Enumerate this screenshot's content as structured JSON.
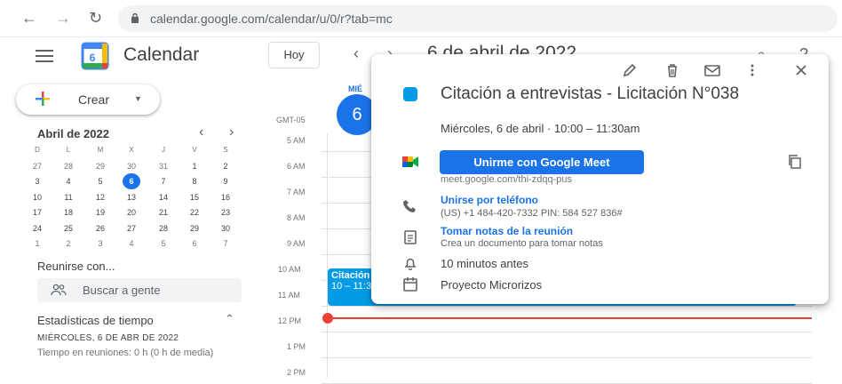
{
  "browser": {
    "url": "calendar.google.com/calendar/u/0/r?tab=mc"
  },
  "header": {
    "app_title": "Calendar",
    "logo_number": "6",
    "today_label": "Hoy",
    "date_title": "6 de abril de 2022"
  },
  "sidebar": {
    "create_label": "Crear",
    "mini_calendar": {
      "title": "Abril de 2022",
      "weekdays": [
        "D",
        "L",
        "M",
        "X",
        "J",
        "V",
        "S"
      ],
      "weeks": [
        [
          "27",
          "28",
          "29",
          "30",
          "31",
          "1",
          "2"
        ],
        [
          "3",
          "4",
          "5",
          "6",
          "7",
          "8",
          "9"
        ],
        [
          "10",
          "11",
          "12",
          "13",
          "14",
          "15",
          "16"
        ],
        [
          "17",
          "18",
          "19",
          "20",
          "21",
          "22",
          "23"
        ],
        [
          "24",
          "25",
          "26",
          "27",
          "28",
          "29",
          "30"
        ],
        [
          "1",
          "2",
          "3",
          "4",
          "5",
          "6",
          "7"
        ]
      ],
      "selected_day": "6"
    },
    "meet_title": "Reunirse con...",
    "search_people_placeholder": "Buscar a gente",
    "stats_title": "Estadísticas de tiempo",
    "stats_date": "MIÉRCOLES, 6 DE ABR DE 2022",
    "stats_info": "Tiempo en reuniones: 0 h (0 h de media)"
  },
  "day_view": {
    "dow_label": "MIÉ",
    "day_number": "6",
    "timezone": "GMT-05",
    "hours": [
      "5 AM",
      "6 AM",
      "7 AM",
      "8 AM",
      "9 AM",
      "10 AM",
      "11 AM",
      "12 PM",
      "1 PM",
      "2 PM"
    ],
    "event_title": "Citación a entrevistas - Licitación N°038",
    "event_time": "10 – 11:30am"
  },
  "popup": {
    "title": "Citación a entrevistas - Licitación N°038",
    "when": "Miércoles, 6 de abril  ·  10:00 – 11:30am",
    "meet_button": "Unirme con Google Meet",
    "meet_url": "meet.google.com/thi-zdqq-pus",
    "phone_link": "Unirse por teléfono",
    "phone_detail": "(US) +1 484-420-7332 PIN: 584 527 836#",
    "notes_link": "Tomar notas de la reunión",
    "notes_detail": "Crea un documento para tomar notas",
    "reminder": "10 minutos antes",
    "calendar_name": "Proyecto Microrizos"
  },
  "colors": {
    "accent": "#1a73e8",
    "event": "#039be5",
    "now_line": "#ea4335"
  }
}
